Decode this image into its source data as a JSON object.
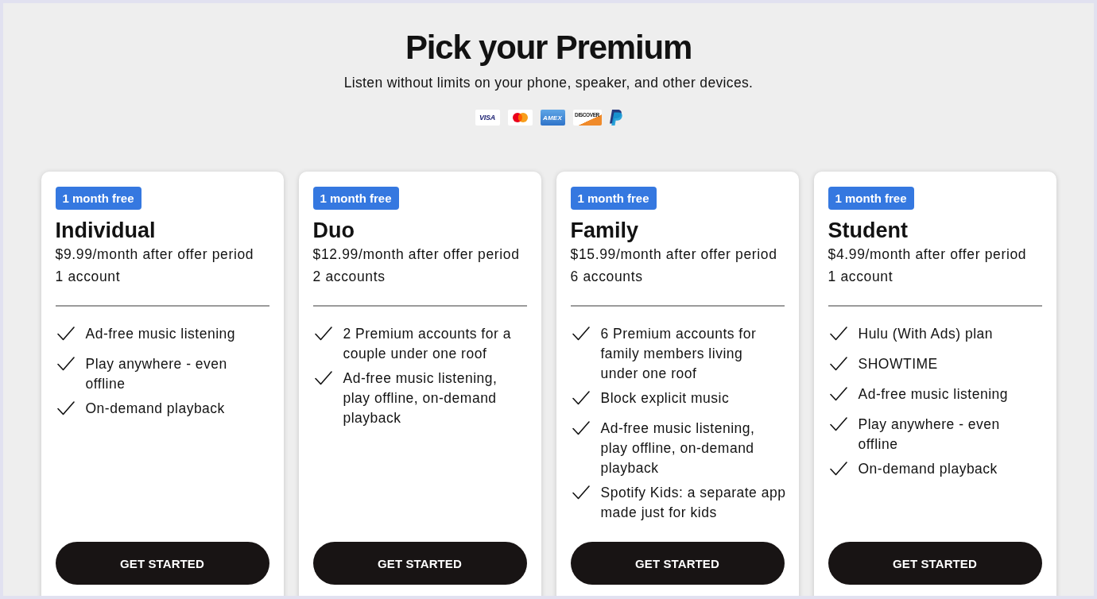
{
  "header": {
    "title": "Pick your Premium",
    "subtitle": "Listen without limits on your phone, speaker, and other devices."
  },
  "payment_methods": [
    {
      "kind": "wordmark",
      "label": "VISA"
    },
    {
      "kind": "circles"
    },
    {
      "kind": "blue-tile",
      "label": "AMEX"
    },
    {
      "kind": "orange-corner",
      "label": "DISCOVER"
    },
    {
      "kind": "p-mark"
    }
  ],
  "plans": [
    {
      "badge": "1 month free",
      "name": "Individual",
      "price": "$9.99/month after offer period",
      "accounts": "1 account",
      "features": [
        "Ad-free music listening",
        "Play anywhere - even\noffline",
        "On-demand playback"
      ],
      "button": "GET STARTED"
    },
    {
      "badge": "1 month free",
      "name": "Duo",
      "price": "$12.99/month after offer period",
      "accounts": "2 accounts",
      "features": [
        "2 Premium accounts for a\ncouple under one roof",
        "Ad-free music listening,\nplay offline, on-demand\nplayback"
      ],
      "button": "GET STARTED"
    },
    {
      "badge": "1 month free",
      "name": "Family",
      "price": "$15.99/month after offer period",
      "accounts": "6 accounts",
      "features": [
        "6 Premium accounts for\nfamily members living\nunder one roof",
        "Block explicit music",
        "Ad-free music listening,\nplay offline, on-demand\nplayback",
        "Spotify Kids: a separate app\nmade just for kids"
      ],
      "button": "GET STARTED"
    },
    {
      "badge": "1 month free",
      "name": "Student",
      "price": "$4.99/month after offer period",
      "accounts": "1 account",
      "features": [
        "Hulu (With Ads) plan",
        "SHOWTIME",
        "Ad-free music listening",
        "Play anywhere - even\noffline",
        "On-demand playback"
      ],
      "button": "GET STARTED"
    }
  ]
}
